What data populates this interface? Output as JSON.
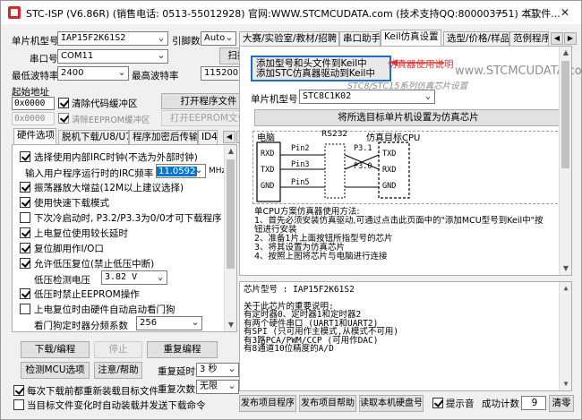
{
  "window": {
    "title": "STC-ISP (V6.86R) (销售电话: 0513-55012928) 官网:WWW.STCMCUDATA.com (技术支持QQ:800003751) 本软件...",
    "minimize": "—",
    "maximize": "□",
    "close": "✕"
  },
  "left": {
    "mcu_type_label": "单片机型号",
    "mcu_type_value": "IAP15F2K61S2",
    "pin_label": "引脚数",
    "pin_value": "Auto",
    "port_label": "串口号",
    "port_value": "COM11",
    "scan_btn": "扫描",
    "min_baud_label": "最低波特率",
    "min_baud_value": "2400",
    "max_baud_label": "最高波特率",
    "max_baud_value": "115200",
    "start_addr_label": "起始地址",
    "addr1": "0x0000",
    "clear_code_label": "清除代码缓冲区",
    "open_prog_btn": "打开程序文件",
    "addr2": "0x0000",
    "clear_eeprom_label": "清除EEPROM缓冲区",
    "open_eeprom_btn": "打开EEPROM文件",
    "tabs": [
      "硬件选项",
      "脱机下载/U8/U7",
      "程序加密后传输",
      "ID4"
    ],
    "hw_options": {
      "opt1": "选择使用内部IRC时钟(不选为外部时钟)",
      "irc_label": "输入用户程序运行时的IRC频率",
      "irc_value": "11.0592",
      "irc_unit": "MHz",
      "opt2": "振荡器放大增益(12M以上建议选择)",
      "opt3": "使用快速下载模式",
      "opt4": "下次冷启动时, P3.2/P3.3为0/0才可下载程序",
      "opt5": "上电复位使用较长延时",
      "opt6": "复位脚用作I/O口",
      "opt7": "允许低压复位(禁止低压中断)",
      "lvd_label": "低压检测电压",
      "lvd_value": "3.82 V",
      "opt8": "低压时禁止EEPROM操作",
      "opt9": "上电复位时由硬件自动启动看门狗",
      "wdt_label": "看门狗定时器分频系数",
      "wdt_value": "256"
    },
    "download_btn": "下载/编程",
    "stop_btn": "停止",
    "reprogram_btn": "重复编程",
    "check_mcu_btn": "检测MCU选项",
    "notice_btn": "注意/帮助",
    "repeat_delay_label": "重复延时",
    "repeat_delay_value": "3 秒",
    "repeat_count_label": "重复次数",
    "repeat_count_value": "无限",
    "reload_label": "每次下载前都重新装载目标文件",
    "auto_send_label": "当目标文件变化时自动装载并发送下载命令"
  },
  "right": {
    "tabs": [
      "大赛/实验室/教材/招聘",
      "串口助手",
      "Keil仿真设置",
      "选型/价格/样品",
      "范例程序"
    ],
    "keil_btn_line1": "添加型号和头文件到Keil中",
    "keil_btn_line2": "添加STC仿真器驱动到Keil中",
    "annotation": "仿真器使用说明",
    "watermark": "www.STCMCUDATA.com",
    "section_title": "STC8/STC15系列仿真芯片设置",
    "mcu_label": "单片机型号",
    "mcu_value": "STC8C1K02",
    "set_emu_btn": "将所选目标单片机设置为仿真芯片",
    "diagram": {
      "pc": "电脑",
      "rs232": "RS232",
      "target": "仿真目标CPU",
      "pc_pins": [
        "RXD",
        "TXD",
        "GND"
      ],
      "mid_pins": [
        "Pin2",
        "Pin3",
        "Pin5"
      ],
      "p3": [
        "P3.1",
        "P3.0"
      ],
      "cpu_pins": [
        "TXD",
        "RXD",
        "GND"
      ]
    },
    "instructions": [
      "单CPU方案仿真器使用方法:",
      "1、首先必须安装仿真驱动,可通过点击此页面中的\"添加MCU型号到Keil中\"按",
      "钮进行安装",
      "2、准备1片上面按钮所指型号的芯片",
      "3、将其设置为仿真芯片",
      "4、按照上图将芯片与电脑进行连接"
    ],
    "info_lines": [
      "芯片型号 : IAP15F2K61S2",
      "",
      "关于此芯片的重要说明:",
      "有定时器0、定时器1和定时器2",
      "有两个硬件串口 (UART1和UART2)",
      "有SPI (只可用作主模式,从模式不可用)",
      "有3路PCA/PWM/CCP (可用作DAC)",
      "有8通道10位精度的A/D"
    ],
    "publish_prog_btn": "发布项目程序",
    "publish_help_btn": "发布项目帮助",
    "read_id_btn": "读取本机硬盘号",
    "tone_label": "提示音",
    "success_label": "成功计数",
    "success_value": "9",
    "clear_btn": "清零"
  },
  "colors": {
    "annotation": "#e4312b",
    "selection": "#0078d7",
    "highlight_box": "#1a6fc9"
  }
}
